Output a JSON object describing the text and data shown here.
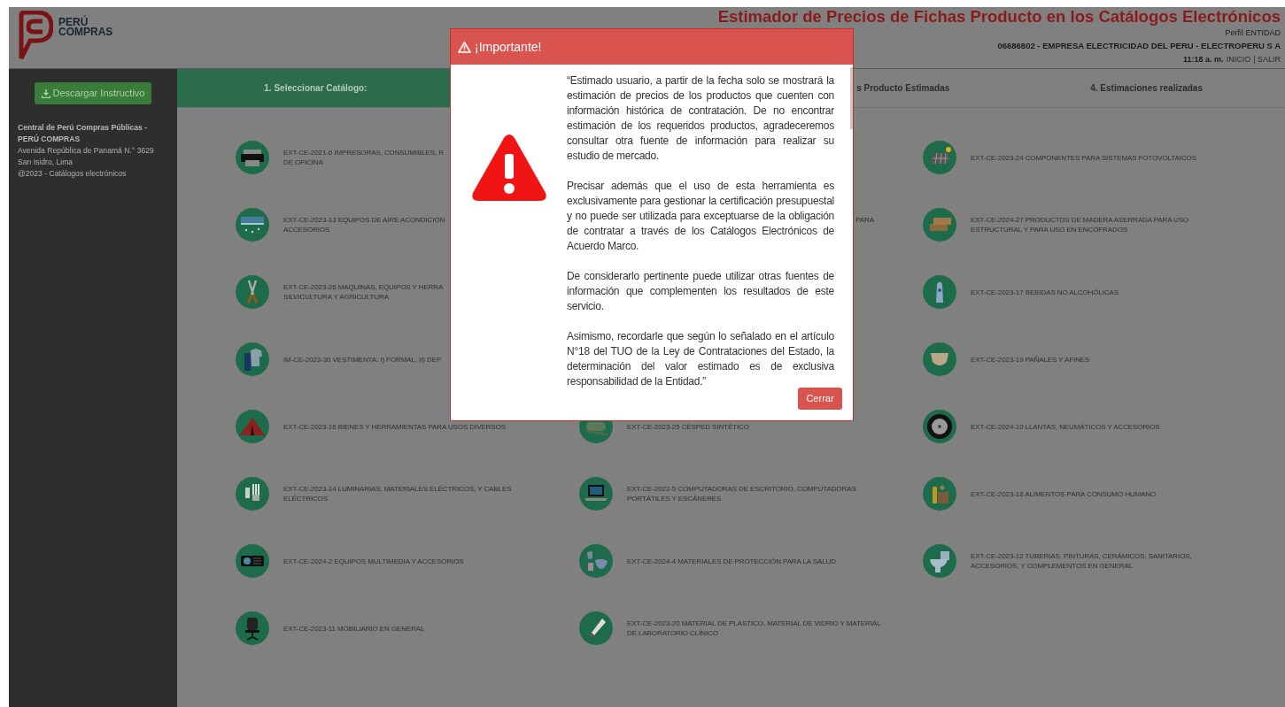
{
  "header": {
    "brand": [
      "PERÚ",
      "COMPRAS"
    ],
    "title": "Estimador de Precios de Fichas Producto en los Catálogos Electrónicos",
    "profile": "Perfil ENTIDAD",
    "company": "06686802 - EMPRESA ELECTRICIDAD DEL PERU - ELECTROPERU S A",
    "time": "11:18 a. m.",
    "links": [
      "INICIO",
      "| SALIR"
    ]
  },
  "sidebar": {
    "download_button": "Descargar Instructivo",
    "org_name": "Central de Perú Compras Públicas - PERÚ COMPRAS",
    "address_lines": [
      "Avenida República de Panamá N.° 3629",
      "San Isidro, Lima",
      "@2023 - Catálogos electrónicos"
    ]
  },
  "tabs": [
    {
      "label": "1. Seleccionar Catálogo:",
      "selected": true,
      "kind": "full"
    },
    {
      "label": "s Producto Estimadas",
      "selected": false,
      "kind": "partial"
    },
    {
      "label": "4. Estimaciones realizadas",
      "selected": false,
      "kind": "full"
    }
  ],
  "catalog_rows": [
    [
      {
        "lines": [
          "EXT-CE-2021-6 IMPRESORAS, CONSUMIBLES, R",
          "DE OFICINA"
        ],
        "kind": "full"
      },
      null,
      {
        "lines": [
          "EXT-CE-2023-24 COMPONENTES PARA SISTEMAS FOTOVOLTAICOS"
        ],
        "kind": "full"
      }
    ],
    [
      {
        "lines": [
          "EXT-CE-2023-13 EQUIPOS DE AIRE ACONDICION",
          "ACCESORIOS"
        ],
        "kind": "full"
      },
      {
        "lines": [
          "PARA"
        ],
        "kind": "partial"
      },
      {
        "lines": [
          "EXT-CE-2024-27 PRODUCTOS DE MADERA ASERRADA PARA USO",
          "ESTRUCTURAL Y PARA USO EN ENCOFRADOS"
        ],
        "kind": "full"
      }
    ],
    [
      {
        "lines": [
          "EXT-CE-2023-26 MAQUINAS, EQUIPOS Y HERRA",
          "SILVICULTURA Y AGRICULTURA"
        ],
        "kind": "full"
      },
      null,
      {
        "lines": [
          "EXT-CE-2023-17 BEBIDAS NO ALCOHÓLICAS"
        ],
        "kind": "full"
      }
    ],
    [
      {
        "lines": [
          "IM-CE-2023-30 VESTIMENTA: I) FORMAL, II) DEP"
        ],
        "kind": "full"
      },
      null,
      {
        "lines": [
          "EXT-CE-2023-19 PAÑALES Y AFINES"
        ],
        "kind": "full"
      }
    ],
    [
      {
        "lines": [
          "EXT-CE-2023-16 BIENES Y HERRAMIENTAS PARA USOS DIVERSOS"
        ],
        "kind": "full"
      },
      {
        "lines": [
          "EXT-CE-2023-25 CÉSPED SINTÉTICO"
        ],
        "kind": "full"
      },
      {
        "lines": [
          "EXT-CE-2024-10 LLANTAS, NEUMÁTICOS Y ACCESORIOS"
        ],
        "kind": "full"
      }
    ],
    [
      {
        "lines": [
          "EXT-CE-2023-14 LUMINARIAS, MATERIALES ELÉCTRICOS, Y CABLES",
          "ELÉCTRICOS"
        ],
        "kind": "full"
      },
      {
        "lines": [
          "EXT-CE-2022-5 COMPUTADORAS DE ESCRITORIO, COMPUTADORAS",
          "PORTÁTILES Y ESCÁNERES"
        ],
        "kind": "full"
      },
      {
        "lines": [
          "EXT-CE-2023-18 ALIMENTOS PARA CONSUMO HUMANO"
        ],
        "kind": "full"
      }
    ],
    [
      {
        "lines": [
          "EXT-CE-2024-2 EQUIPOS MULTIMEDIA Y ACCESORIOS"
        ],
        "kind": "full"
      },
      {
        "lines": [
          "EXT-CE-2024-4 MATERIALES DE PROTECCIÓN PARA LA SALUD"
        ],
        "kind": "full"
      },
      {
        "lines": [
          "EXT-CE-2023-12 TUBERIAS, PINTURAS, CERÁMICOS, SANITARIOS,",
          "ACCESORIOS, Y COMPLEMENTOS EN GENERAL"
        ],
        "kind": "full"
      }
    ],
    [
      {
        "lines": [
          "EXT-CE-2023-11 MOBILIARIO EN GENERAL"
        ],
        "kind": "full"
      },
      {
        "lines": [
          "EXT-CE-2023-20 MATERIAL DE PLASTICO, MATERIAL DE VIDRIO Y MATERIAL",
          "DE LABORATORIO CLÍNICO"
        ],
        "kind": "full"
      },
      null
    ]
  ],
  "modal": {
    "title": "¡Importante!",
    "paragraphs": [
      "“Estimado usuario, a partir de la fecha solo se mostrará la estimación de precios de los productos que cuenten con información histórica de contratación. De no encontrar estimación de los requeridos productos, agradeceremos consultar otra fuente de información para realizar su estudio de mercado.",
      "Precisar además que el uso de esta herramienta es exclusivamente para gestionar la certificación presupuestal y no puede ser utilizada para exceptuarse de la obligación de contratar a través de los Catálogos Electrónicos de Acuerdo Marco.",
      "De considerarlo pertinente puede utilizar otras fuentes de información que complementen los resultados de este servicio.",
      "Asimismo, recordarle que según lo señalado en el artículo N°18 del TUO de la Ley de Contrataciones del Estado, la determinación del valor estimado es de exclusiva responsabilidad de la Entidad.”"
    ],
    "close_button": "Cerrar"
  }
}
